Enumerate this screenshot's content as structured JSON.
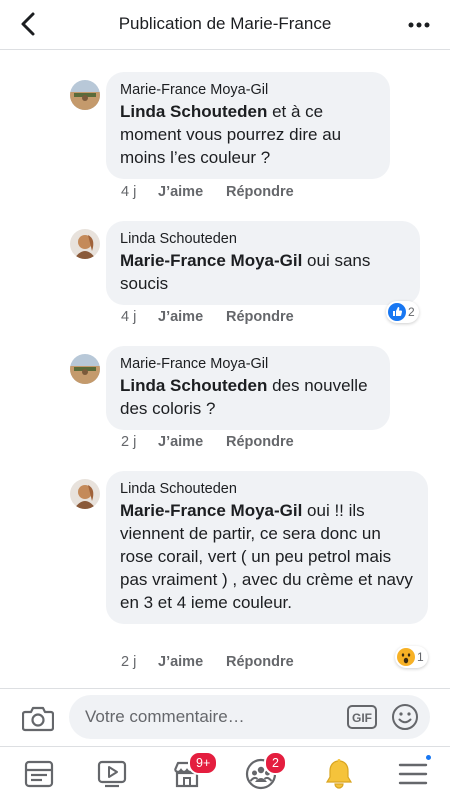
{
  "header": {
    "title": "Publication de Marie-France"
  },
  "comments": [
    {
      "author": "Marie-France Moya-Gil",
      "mention": "Linda Schouteden",
      "text": " et à ce moment vous pourrez dire au moins l’es couleur ?",
      "time": "4 j",
      "like": "J’aime",
      "reply": "Répondre"
    },
    {
      "author": "Linda Schouteden",
      "mention": "Marie-France Moya-Gil",
      "text": " oui sans soucis",
      "time": "4 j",
      "like": "J’aime",
      "reply": "Répondre",
      "reaction": {
        "icon": "like-reaction-icon",
        "count": "2"
      }
    },
    {
      "author": "Marie-France Moya-Gil",
      "mention": "Linda Schouteden",
      "text": " des nouvelle des coloris ?",
      "time": "2 j",
      "like": "J’aime",
      "reply": "Répondre"
    },
    {
      "author": "Linda Schouteden",
      "mention": "Marie-France Moya-Gil",
      "text": " oui !! ils viennent de partir, ce sera donc un rose corail, vert ( un peu petrol mais pas vraiment ) , avec du crème et navy en 3 et 4 ieme couleur.",
      "time": "2 j",
      "like": "J’aime",
      "reply": "Répondre",
      "reaction": {
        "icon": "wow-reaction-icon",
        "count": "1"
      }
    }
  ],
  "composer": {
    "placeholder": "Votre commentaire…",
    "gif_label": "GIF"
  },
  "nav": {
    "marketplace_badge": "9+",
    "groups_badge": "2"
  },
  "colors": {
    "accent": "#1877f2",
    "badge": "#e41e3f",
    "bubble": "#f0f2f5"
  }
}
